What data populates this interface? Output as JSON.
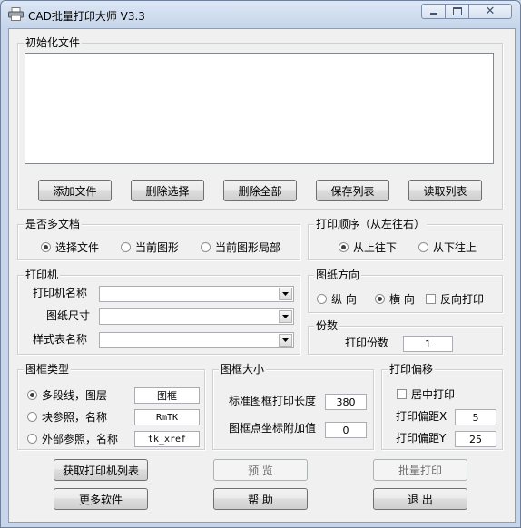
{
  "window": {
    "title": "CAD批量打印大师 V3.3"
  },
  "file_group": {
    "legend": "初始化文件",
    "buttons": {
      "add": "添加文件",
      "delete_selected": "删除选择",
      "delete_all": "删除全部",
      "save_list": "保存列表",
      "read_list": "读取列表"
    }
  },
  "multi_doc": {
    "legend": "是否多文档",
    "options": {
      "select_file": "选择文件",
      "current_drawing": "当前图形",
      "current_drawing_part": "当前图形局部"
    },
    "selected": "select_file"
  },
  "print_order": {
    "legend": "打印顺序（从左往右）",
    "options": {
      "top_down": "从上往下",
      "bottom_up": "从下往上"
    },
    "selected": "top_down"
  },
  "printer": {
    "legend": "打印机",
    "printer_name_label": "打印机名称",
    "printer_name_value": "",
    "paper_size_label": "图纸尺寸",
    "paper_size_value": "",
    "style_table_label": "样式表名称",
    "style_table_value": ""
  },
  "orientation": {
    "legend": "图纸方向",
    "portrait": "纵 向",
    "landscape": "横 向",
    "reverse_print": "反向打印",
    "selected": "landscape",
    "reverse_checked": false
  },
  "copies": {
    "legend": "份数",
    "label": "打印份数",
    "value": "1"
  },
  "frame_type": {
    "legend": "图框类型",
    "polyline_label": "多段线，图层",
    "polyline_value": "图框",
    "block_label": "块参照，名称",
    "block_value": "RmTK",
    "xref_label": "外部参照，名称",
    "xref_value": "tk_xref",
    "selected": "polyline"
  },
  "frame_size": {
    "legend": "图框大小",
    "std_length_label": "标准图框打印长度",
    "std_length_value": "380",
    "coord_add_label": "图框点坐标附加值",
    "coord_add_value": "0"
  },
  "print_offset": {
    "legend": "打印偏移",
    "center_label": "居中打印",
    "center_checked": false,
    "offset_x_label": "打印偏距X",
    "offset_x_value": "5",
    "offset_y_label": "打印偏距Y",
    "offset_y_value": "25"
  },
  "actions": {
    "get_printers": "获取打印机列表",
    "preview": "预 览",
    "batch_print": "批量打印",
    "more_software": "更多软件",
    "help": "帮 助",
    "exit": "退 出"
  }
}
